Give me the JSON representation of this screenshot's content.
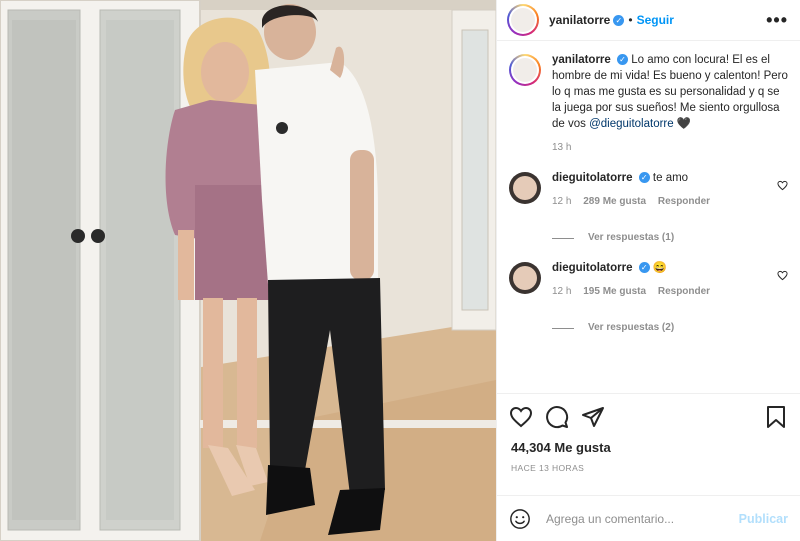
{
  "header": {
    "username": "yanilatorre",
    "separator": "•",
    "follow_label": "Seguir",
    "more_label": "•••"
  },
  "caption": {
    "username": "yanilatorre",
    "text": "Lo amo con locura! El es el hombre de mi vida! Es bueno y calenton! Pero lo q mas me gusta es su personalidad y q se la juega por sus sueños! Me siento orgullosa de vos",
    "mention": "@dieguitolatorre",
    "emoji": "🖤",
    "time": "13 h"
  },
  "comments": [
    {
      "username": "dieguitolatorre",
      "text": "te amo",
      "time": "12 h",
      "likes": "289 Me gusta",
      "reply_label": "Responder",
      "view_replies": "Ver respuestas (1)"
    },
    {
      "username": "dieguitolatorre",
      "text": "😄",
      "time": "12 h",
      "likes": "195 Me gusta",
      "reply_label": "Responder",
      "view_replies": "Ver respuestas (2)"
    }
  ],
  "footer": {
    "likes_count": "44,304 Me gusta",
    "timestamp": "HACE 13 HORAS",
    "comment_placeholder": "Agrega un comentario...",
    "post_label": "Publicar"
  },
  "icons": {
    "like": "heart-icon",
    "comment": "comment-icon",
    "share": "share-icon",
    "save": "bookmark-icon",
    "emoji": "smiley-icon",
    "verified": "verified-badge-icon"
  },
  "colors": {
    "accent": "#0095f6",
    "verified": "#3897f0",
    "muted": "#8e8e8e",
    "post_disabled": "#b2dffc"
  }
}
